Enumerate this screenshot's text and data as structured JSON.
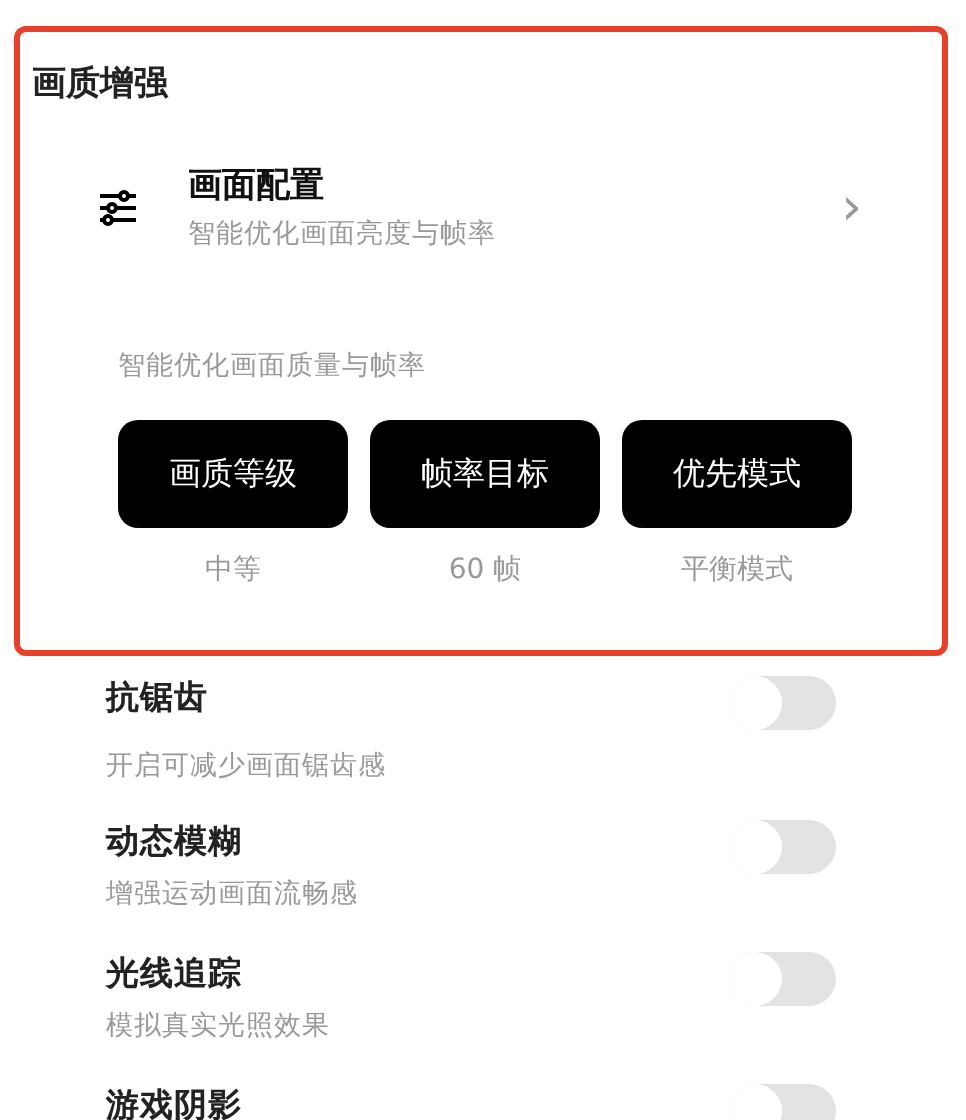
{
  "section": {
    "title": "画质增强",
    "highlighted": true
  },
  "config": {
    "title": "画面配置",
    "subtitle": "智能优化画面亮度与帧率",
    "chevron": "›"
  },
  "presets": {
    "caption": "智能优化画面质量与帧率",
    "items": [
      {
        "label": "画质等级",
        "value": "中等"
      },
      {
        "label": "帧率目标",
        "value": "60 帧"
      },
      {
        "label": "优先模式",
        "value": "平衡模式"
      }
    ]
  },
  "toggles": [
    {
      "title": "抗锯齿",
      "subtitle": "开启可减少画面锯齿感",
      "on": false
    },
    {
      "title": "动态模糊",
      "subtitle": "增强运动画面流畅感",
      "on": false
    },
    {
      "title": "光线追踪",
      "subtitle": "模拟真实光照效果",
      "on": false
    },
    {
      "title": "游戏阴影",
      "on": false
    }
  ]
}
